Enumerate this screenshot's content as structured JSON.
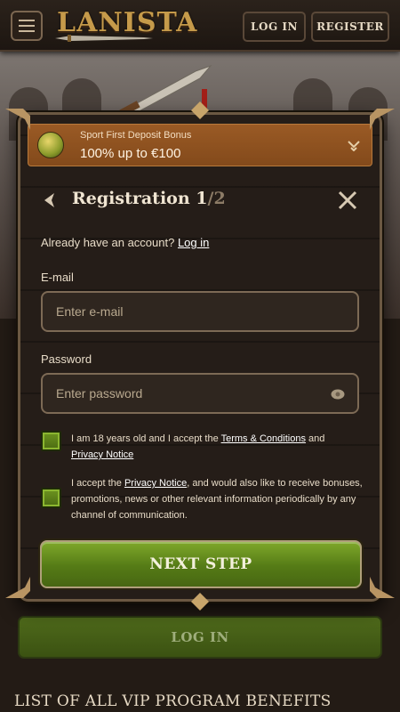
{
  "header": {
    "logo": "LANISTA",
    "login_label": "LOG IN",
    "register_label": "REGISTER"
  },
  "bonus": {
    "subtitle": "Sport First Deposit Bonus",
    "title": "100% up to €100"
  },
  "registration": {
    "title": "Registration 1",
    "step_suffix": "/2",
    "have_account": "Already have an account?",
    "login_link": "Log in",
    "email_label": "E-mail",
    "email_placeholder": "Enter e-mail",
    "password_label": "Password",
    "password_placeholder": "Enter password",
    "consent1_pre": "I am 18 years old and I accept the ",
    "consent1_link1": "Terms & Conditions",
    "consent1_mid": " and",
    "consent1_link2": "Privacy Notice",
    "consent2_pre": "I accept the ",
    "consent2_link": "Privacy Notice",
    "consent2_post": ", and would also like to receive bonuses, promotions, news or other relevant information periodically by any channel of communication.",
    "next_label": "NEXT STEP"
  },
  "page": {
    "login_button": "LOG IN",
    "vip_title": "LIST OF ALL VIP PROGRAM BENEFITS"
  }
}
